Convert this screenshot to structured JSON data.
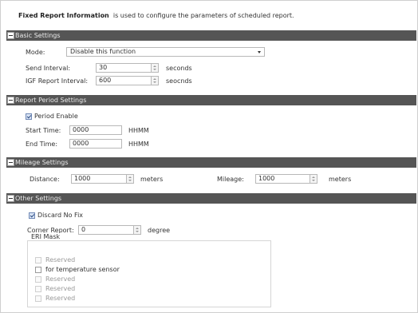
{
  "header": {
    "title": "Fixed Report Information",
    "description": "is used to configure the parameters of scheduled report."
  },
  "sections": {
    "basic": {
      "title": "Basic Settings",
      "mode_label": "Mode:",
      "mode_value": "Disable this function",
      "send_interval_label": "Send Interval:",
      "send_interval_value": "30",
      "send_interval_unit": "seconds",
      "igf_label": "IGF Report Interval:",
      "igf_value": "600",
      "igf_unit": "seocnds"
    },
    "report_period": {
      "title": "Report Period Settings",
      "period_enable_label": "Period Enable",
      "period_enable_checked": true,
      "start_label": "Start Time:",
      "start_value": "0000",
      "start_unit": "HHMM",
      "end_label": "End Time:",
      "end_value": "0000",
      "end_unit": "HHMM"
    },
    "mileage": {
      "title": "Mileage Settings",
      "distance_label": "Distance:",
      "distance_value": "1000",
      "distance_unit": "meters",
      "mileage_label": "Mileage:",
      "mileage_value": "1000",
      "mileage_unit": "meters"
    },
    "other": {
      "title": "Other Settings",
      "discard_label": "Discard No Fix",
      "discard_checked": true,
      "corner_label": "Corner Report:",
      "corner_value": "0",
      "corner_unit": "degree",
      "eri_title": "ERI Mask",
      "eri_items": [
        {
          "label": "Reserved",
          "enabled": false,
          "checked": false
        },
        {
          "label": "for temperature sensor",
          "enabled": true,
          "checked": false
        },
        {
          "label": "Reserved",
          "enabled": false,
          "checked": false
        },
        {
          "label": "Reserved",
          "enabled": false,
          "checked": false
        },
        {
          "label": "Reserved",
          "enabled": false,
          "checked": false
        }
      ]
    }
  }
}
